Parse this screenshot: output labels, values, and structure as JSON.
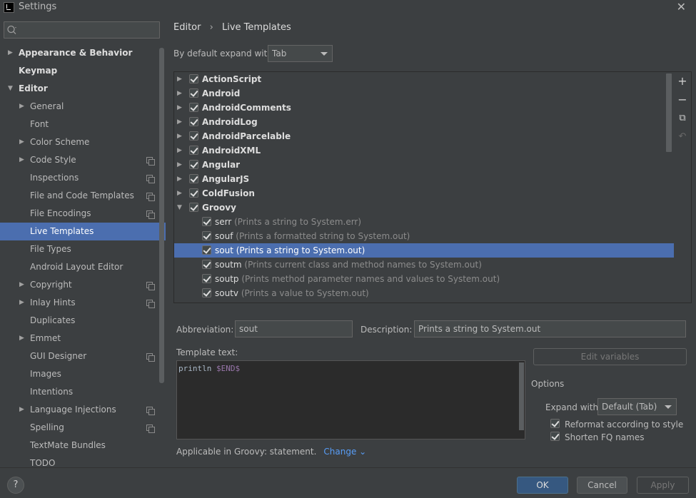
{
  "window": {
    "title": "Settings",
    "close_glyph": "✕"
  },
  "search": {
    "placeholder": ""
  },
  "sidebar": {
    "items": [
      {
        "label": "Appearance & Behavior",
        "bold": true,
        "arrow": "▶"
      },
      {
        "label": "Keymap",
        "bold": true,
        "arrow": ""
      },
      {
        "label": "Editor",
        "bold": true,
        "arrow": "▼"
      },
      {
        "label": "General",
        "arrow": "▶"
      },
      {
        "label": "Font",
        "arrow": ""
      },
      {
        "label": "Color Scheme",
        "arrow": "▶"
      },
      {
        "label": "Code Style",
        "arrow": "▶",
        "project": true
      },
      {
        "label": "Inspections",
        "arrow": "",
        "project": true
      },
      {
        "label": "File and Code Templates",
        "arrow": "",
        "project": true
      },
      {
        "label": "File Encodings",
        "arrow": "",
        "project": true
      },
      {
        "label": "Live Templates",
        "arrow": "",
        "selected": true
      },
      {
        "label": "File Types",
        "arrow": ""
      },
      {
        "label": "Android Layout Editor",
        "arrow": ""
      },
      {
        "label": "Copyright",
        "arrow": "▶",
        "project": true
      },
      {
        "label": "Inlay Hints",
        "arrow": "▶",
        "project": true
      },
      {
        "label": "Duplicates",
        "arrow": ""
      },
      {
        "label": "Emmet",
        "arrow": "▶"
      },
      {
        "label": "GUI Designer",
        "arrow": "",
        "project": true
      },
      {
        "label": "Images",
        "arrow": ""
      },
      {
        "label": "Intentions",
        "arrow": ""
      },
      {
        "label": "Language Injections",
        "arrow": "▶",
        "project": true
      },
      {
        "label": "Spelling",
        "arrow": "",
        "project": true
      },
      {
        "label": "TextMate Bundles",
        "arrow": ""
      },
      {
        "label": "TODO",
        "arrow": ""
      }
    ]
  },
  "breadcrumb": {
    "parent": "Editor",
    "separator": "›",
    "current": "Live Templates"
  },
  "expand": {
    "label": "By default expand with",
    "value": "Tab"
  },
  "templates": {
    "groups": [
      {
        "name": "ActionScript",
        "arrow": "▶"
      },
      {
        "name": "Android",
        "arrow": "▶"
      },
      {
        "name": "AndroidComments",
        "arrow": "▶"
      },
      {
        "name": "AndroidLog",
        "arrow": "▶"
      },
      {
        "name": "AndroidParcelable",
        "arrow": "▶"
      },
      {
        "name": "AndroidXML",
        "arrow": "▶"
      },
      {
        "name": "Angular",
        "arrow": "▶"
      },
      {
        "name": "AngularJS",
        "arrow": "▶"
      },
      {
        "name": "ColdFusion",
        "arrow": "▶"
      },
      {
        "name": "Groovy",
        "arrow": "▼"
      }
    ],
    "items": [
      {
        "abbr": "serr",
        "desc": "(Prints a string to System.err)"
      },
      {
        "abbr": "souf",
        "desc": "(Prints a formatted string to System.out)"
      },
      {
        "abbr": "sout",
        "desc": "(Prints a string to System.out)",
        "selected": true
      },
      {
        "abbr": "soutm",
        "desc": "(Prints current class and method names to System.out)"
      },
      {
        "abbr": "soutp",
        "desc": "(Prints method parameter names and values to System.out)"
      },
      {
        "abbr": "soutv",
        "desc": "(Prints a value to System.out)"
      }
    ],
    "toolbar": {
      "add": "+",
      "remove": "−",
      "copy": "⧉",
      "restore": "↶"
    }
  },
  "details": {
    "abbreviation_label": "Abbreviation:",
    "abbreviation_value": "sout",
    "description_label": "Description:",
    "description_value": "Prints a string to System.out",
    "template_text_label": "Template text:",
    "template_code": "println ",
    "template_var": "$END$",
    "edit_variables": "Edit variables",
    "options_title": "Options",
    "expand_with_label": "Expand with",
    "expand_with_value": "Default (Tab)",
    "reformat_label": "Reformat according to style",
    "shorten_label": "Shorten FQ names",
    "applicable_text": "Applicable in Groovy: statement.",
    "change_link": "Change ⌄"
  },
  "buttons": {
    "help": "?",
    "ok": "OK",
    "cancel": "Cancel",
    "apply": "Apply"
  }
}
